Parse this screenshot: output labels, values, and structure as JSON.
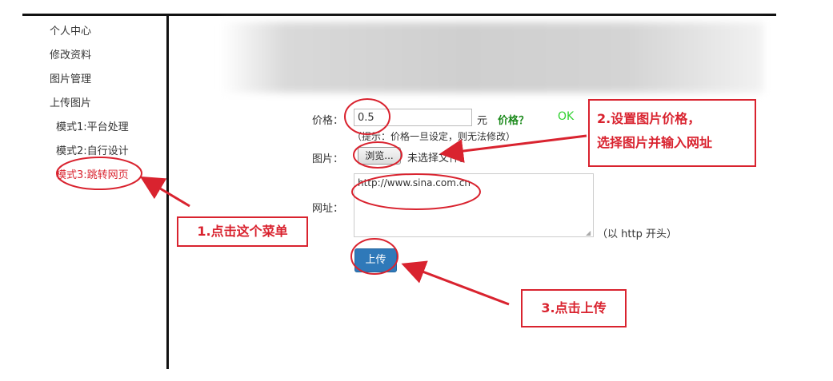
{
  "sidebar": {
    "items": [
      {
        "label": "个人中心"
      },
      {
        "label": "修改资料"
      },
      {
        "label": "图片管理"
      },
      {
        "label": "上传图片"
      },
      {
        "label": "模式1:平台处理"
      },
      {
        "label": "模式2:自行设计"
      },
      {
        "label": "模式3:跳转网页"
      }
    ]
  },
  "form": {
    "price_label": "价格：",
    "price_value": "0.5",
    "price_unit": "元",
    "price_help_link": "价格？",
    "price_ok": "OK",
    "price_hint": "（提示：价格一旦设定，则无法修改）",
    "image_label": "图片：",
    "browse_label": "浏览...",
    "no_file_text": "未选择文件。",
    "url_label": "网址：",
    "url_value": "http://www.sina.com.cn",
    "url_hint": "（以 http 开头）",
    "upload_label": "上传"
  },
  "callouts": {
    "step1": "1.点击这个菜单",
    "step2_line1": "2.设置图片价格，",
    "step2_line2": "选择图片并输入网址",
    "step3": "3.点击上传"
  },
  "colors": {
    "annotation": "#d9232f",
    "button": "#2f79b9",
    "ok": "#2fd12f",
    "help_link": "#1e8b1e"
  }
}
